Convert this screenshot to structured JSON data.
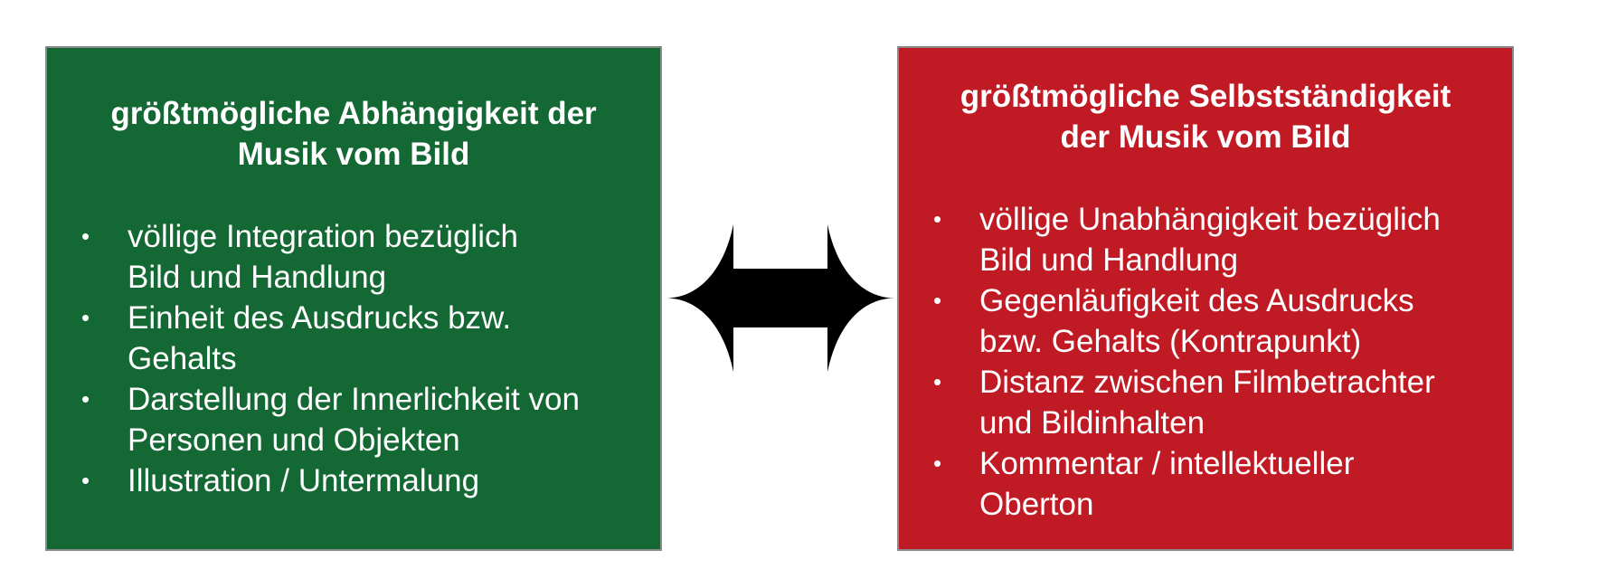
{
  "colors": {
    "left_panel": "#136833",
    "right_panel": "#c01a24",
    "text": "#ffffff",
    "arrow": "#000000"
  },
  "left_panel": {
    "title_line1": "größtmögliche Abhängigkeit der",
    "title_line2": "Musik vom Bild",
    "items": [
      {
        "line1": "völlige Integration bezüglich",
        "line2": "Bild und Handlung"
      },
      {
        "line1": "Einheit des Ausdrucks bzw.",
        "line2": "Gehalts"
      },
      {
        "line1": "Darstellung der Innerlichkeit von",
        "line2": "Personen und Objekten"
      },
      {
        "line1": "Illustration / Untermalung",
        "line2": ""
      }
    ]
  },
  "right_panel": {
    "title_line1": "größtmögliche Selbstständigkeit",
    "title_line2": "der Musik vom Bild",
    "items": [
      {
        "line1": "völlige Unabhängigkeit bezüglich",
        "line2": "Bild und Handlung"
      },
      {
        "line1": "Gegenläufigkeit des Ausdrucks",
        "line2": "bzw. Gehalts (Kontrapunkt)"
      },
      {
        "line1": "Distanz zwischen Filmbetrachter",
        "line2": "und Bildinhalten"
      },
      {
        "line1": "Kommentar / intellektueller",
        "line2": "Oberton"
      }
    ]
  },
  "connector": {
    "icon": "double-headed-arrow-icon"
  }
}
